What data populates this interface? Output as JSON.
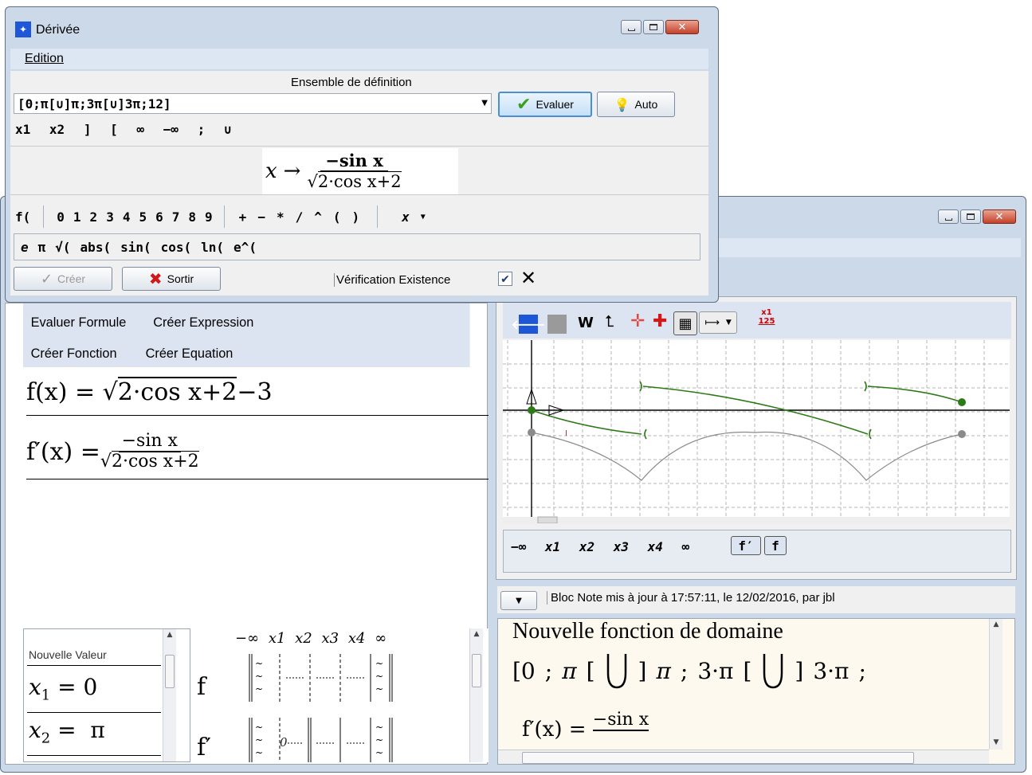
{
  "dialog": {
    "title": "Dérivée",
    "menu": "Edition",
    "domain_label": "Ensemble de définition",
    "domain_value": "[0;π[∪]π;3π[∪]3π;12]",
    "evaluer_label": "Evaluer",
    "auto_label": "Auto",
    "symbol_keys": [
      "x1",
      "x2",
      "]",
      "[",
      "∞",
      "−∞",
      ";",
      "∪"
    ],
    "preview": {
      "lhs": "x",
      "arrow": "→",
      "num": "−sin x",
      "den": "2·cos x+2"
    },
    "keypad_f": "f(",
    "keypad_digits": [
      "0",
      "1",
      "2",
      "3",
      "4",
      "5",
      "6",
      "7",
      "8",
      "9"
    ],
    "keypad_ops": [
      "+",
      "−",
      "*",
      "∕",
      "^",
      "(",
      ")"
    ],
    "keypad_var": "x",
    "funcs": [
      "e",
      "π",
      "√(",
      "abs(",
      "sin(",
      "cos(",
      "ln(",
      "e^("
    ],
    "creer_label": "Créer",
    "sortir_label": "Sortir",
    "verif_label": "Vérification Existence"
  },
  "left_panel": {
    "menu_row1": [
      "Evaluer Formule",
      "Créer Expression"
    ],
    "menu_row2": [
      "Créer Fonction",
      "Créer Equation"
    ],
    "f_formula": {
      "lhs": "f(x) = ",
      "rad": "2·cos x+2",
      "tail": "−3"
    },
    "fp_formula": {
      "lhs": "f′(x) = ",
      "num": "−sin x",
      "den": "2·cos x+2"
    },
    "values": {
      "header": "Nouvelle Valeur",
      "x1": {
        "name": "x",
        "sub": "1",
        "value": "= 0"
      },
      "x2": {
        "name": "x",
        "sub": "2",
        "value": "=  π"
      }
    },
    "table": {
      "header": [
        "−∞",
        "x1",
        "x2",
        "x3",
        "x4",
        "∞"
      ],
      "rows": [
        "f",
        "f′"
      ],
      "zero": "0"
    }
  },
  "right_panel": {
    "toolbar": {
      "w_label": "W",
      "scale_top": "x1",
      "scale_bot": "125"
    },
    "graph_keys": [
      "−∞",
      "x1",
      "x2",
      "x3",
      "x4",
      "∞"
    ],
    "fprime_key": "f′",
    "f_key": "f",
    "note_status": "Bloc Note mis à jour à 17:57:11, le 12/02/2016, par jbl",
    "note": {
      "line1": "Nouvelle fonction de domaine",
      "line2": [
        "[0",
        ";",
        "π",
        "[",
        "]",
        "π",
        ";",
        "3·π",
        "[",
        "]",
        "3·π",
        ";"
      ],
      "line3_lhs": "f′(x) = ",
      "line3_num": "−sin x"
    }
  },
  "colors": {
    "accent": "#2c7a16",
    "titlebar": "#cfdcec",
    "menu": "#dde6f3",
    "note_bg": "#fdf9ee",
    "graph_gray": "#8a8a8a"
  },
  "icons": [
    "app-icon",
    "minimize-icon",
    "maximize-icon",
    "close-icon",
    "checkmark-icon",
    "bulb-icon",
    "cross-icon",
    "back-arrow-icon",
    "grid-icon",
    "dropdown-arrow-icon"
  ]
}
